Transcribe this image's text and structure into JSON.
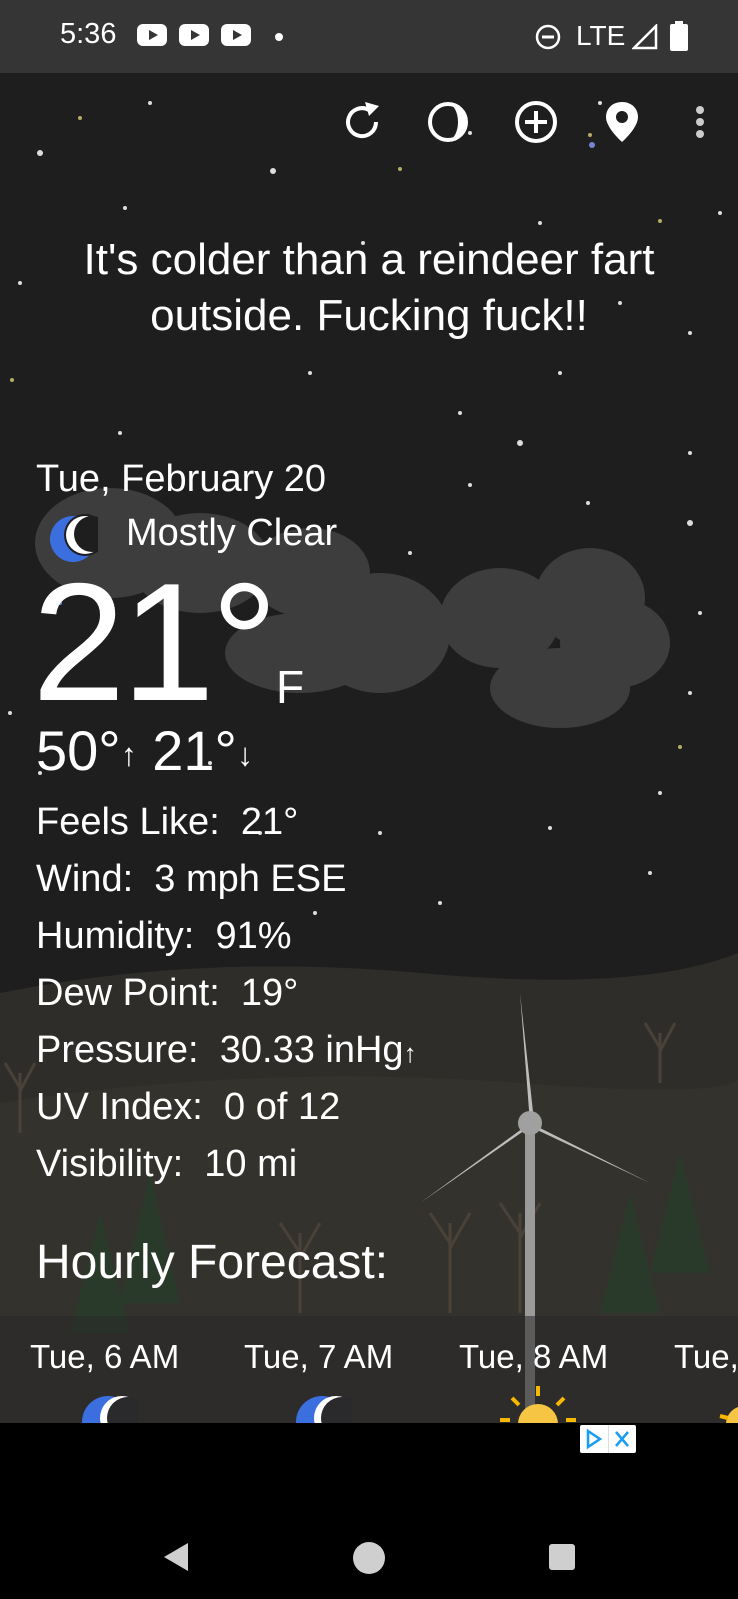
{
  "status_bar": {
    "time": "5:36",
    "network": "LTE"
  },
  "toolbar": {
    "icons": [
      "refresh-icon",
      "moon-phase-icon",
      "add-location-icon",
      "location-pin-icon",
      "more-vert-icon"
    ]
  },
  "headline": "It's colder than a reindeer fart outside. Fucking fuck!!",
  "current": {
    "date": "Tue, February 20",
    "condition": "Mostly Clear",
    "temperature": "21°",
    "unit": "F",
    "high": "50°",
    "low": "21°"
  },
  "details": [
    {
      "label": "Feels Like:",
      "value": "21°"
    },
    {
      "label": "Wind:",
      "value": "3 mph ESE"
    },
    {
      "label": "Humidity:",
      "value": "91%"
    },
    {
      "label": "Dew Point:",
      "value": "19°"
    },
    {
      "label": "Pressure:",
      "value": "30.33 inHg"
    },
    {
      "label": "UV Index:",
      "value": "0 of 12"
    },
    {
      "label": "Visibility:",
      "value": "10 mi"
    }
  ],
  "hourly": {
    "title": "Hourly Forecast:",
    "items": [
      {
        "label": "Tue, 6 AM",
        "icon": "moon-icon"
      },
      {
        "label": "Tue, 7 AM",
        "icon": "moon-icon"
      },
      {
        "label": "Tue, 8 AM",
        "icon": "sun-icon"
      },
      {
        "label": "Tue,",
        "icon": "sun-icon"
      }
    ]
  },
  "colors": {
    "background": "#1e1e1f",
    "status_bar": "#353536",
    "moon": "#3b6fe0",
    "sun": "#f6c544",
    "ad_badge": "#1a9cf0"
  }
}
